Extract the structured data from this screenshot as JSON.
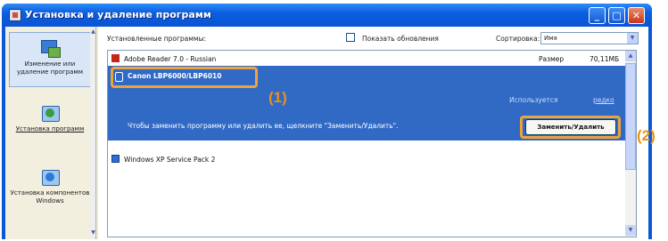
{
  "window": {
    "title": "Установка и удаление программ",
    "controls": {
      "minimize": "_",
      "maximize": "□",
      "close": "✕"
    }
  },
  "sidebar": {
    "items": [
      {
        "label": "Изменение или удаление программ",
        "icon": "add-remove-programs-icon",
        "active": true
      },
      {
        "label": "Установка программ",
        "icon": "install-programs-icon",
        "active": false
      },
      {
        "label": "Установка компонентов Windows",
        "icon": "windows-components-icon",
        "active": false
      }
    ]
  },
  "toolbar": {
    "installed_label": "Установленные программы:",
    "show_updates_label": "Показать обновления",
    "show_updates_checked": false,
    "sort_label": "Сортировка:",
    "sort_value": "Имя"
  },
  "programs": [
    {
      "name": "Adobe Reader 7.0 - Russian",
      "size_label": "Размер",
      "size_value": "70,11МБ",
      "icon": "adobe-reader-icon"
    },
    {
      "name": "Canon LBP6000/LBP6010",
      "selected": true,
      "used_label": "Используется",
      "used_value": "редко",
      "hint": "Чтобы заменить программу или удалить ее, щелкните \"Заменить/Удалить\".",
      "button_label": "Заменить/Удалить",
      "icon": "printer-icon"
    },
    {
      "name": "Windows XP Service Pack 2",
      "icon": "windows-update-icon"
    }
  ],
  "callouts": {
    "first": "(1)",
    "second": "(2)"
  },
  "colors": {
    "titlebar": "#0a5fe0",
    "selection": "#316ac5",
    "highlight_border": "#f0a23a"
  }
}
